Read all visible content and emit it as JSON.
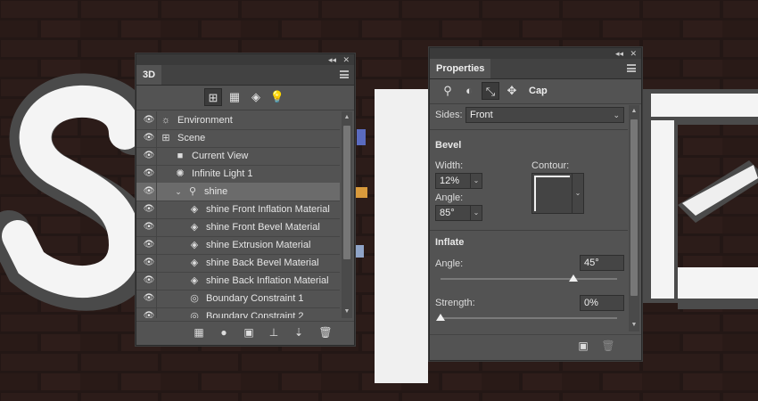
{
  "panel3d": {
    "tab": "3D",
    "filter_icons": [
      "whole-scene-filter-icon",
      "meshes-filter-icon",
      "materials-filter-icon",
      "lights-filter-icon"
    ],
    "layers": [
      {
        "label": "Environment",
        "icon": "environment-icon",
        "indent": 0,
        "selected": false
      },
      {
        "label": "Scene",
        "icon": "scene-icon",
        "indent": 0,
        "selected": false
      },
      {
        "label": "Current View",
        "icon": "camera-icon",
        "indent": 1,
        "selected": false
      },
      {
        "label": "Infinite Light 1",
        "icon": "light-icon",
        "indent": 1,
        "selected": false
      },
      {
        "label": "shine",
        "icon": "mesh-icon",
        "indent": 1,
        "selected": true
      },
      {
        "label": "shine Front Inflation Material",
        "icon": "material-icon",
        "indent": 2,
        "selected": false
      },
      {
        "label": "shine Front Bevel Material",
        "icon": "material-icon",
        "indent": 2,
        "selected": false
      },
      {
        "label": "shine Extrusion Material",
        "icon": "material-icon",
        "indent": 2,
        "selected": false
      },
      {
        "label": "shine Back Bevel Material",
        "icon": "material-icon",
        "indent": 2,
        "selected": false
      },
      {
        "label": "shine Back Inflation Material",
        "icon": "material-icon",
        "indent": 2,
        "selected": false
      },
      {
        "label": "Boundary Constraint 1",
        "icon": "constraint-icon",
        "indent": 2,
        "selected": false
      },
      {
        "label": "Boundary Constraint 2",
        "icon": "constraint-icon",
        "indent": 2,
        "selected": false
      }
    ]
  },
  "properties": {
    "tab": "Properties",
    "cap_label": "Cap",
    "sides_label": "Sides:",
    "sides_value": "Front",
    "bevel": {
      "title": "Bevel",
      "width_label": "Width:",
      "width_value": "12%",
      "contour_label": "Contour:",
      "angle_label": "Angle:",
      "angle_value": "85°"
    },
    "inflate": {
      "title": "Inflate",
      "angle_label": "Angle:",
      "angle_value": "45°",
      "angle_fraction": 0.75,
      "strength_label": "Strength:",
      "strength_value": "0%",
      "strength_fraction": 0.0
    }
  },
  "colors": {
    "panel": "#535353",
    "selected_row": "#6b6b6b",
    "background": "#1e1513"
  }
}
